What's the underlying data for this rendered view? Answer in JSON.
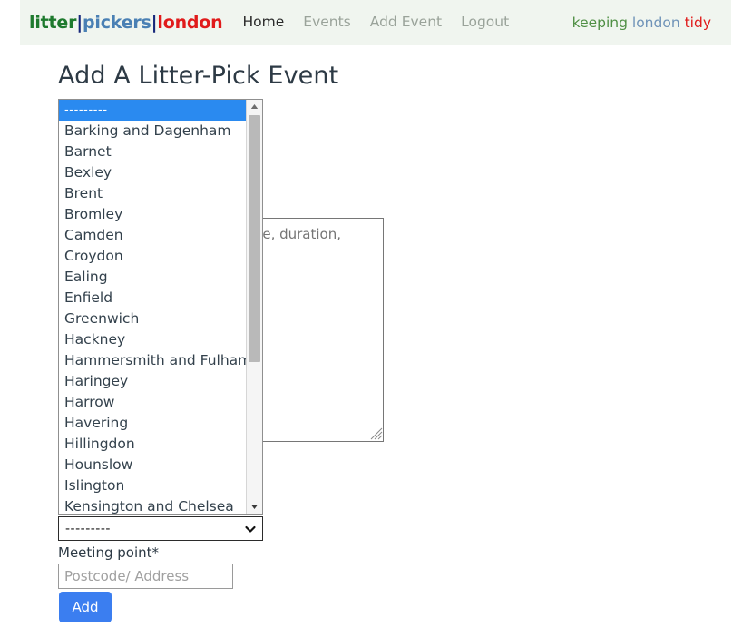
{
  "navbar": {
    "brand": {
      "part1": "litter",
      "sep1": "|",
      "part2": "pickers",
      "sep2": "|",
      "part3": "london"
    },
    "links": [
      {
        "label": "Home",
        "active": true
      },
      {
        "label": "Events",
        "active": false
      },
      {
        "label": "Add Event",
        "active": false
      },
      {
        "label": "Logout",
        "active": false
      }
    ],
    "tagline": {
      "word1": "keeping",
      "word2": "london",
      "word3": "tidy"
    },
    "background": "#f0f5ef"
  },
  "page": {
    "title": "Add A Litter-Pick Event"
  },
  "form": {
    "description": {
      "placeholder": "Details of the Litter-Pick. Time, duration, contact details..."
    },
    "borough_select": {
      "value": "---------",
      "caret_icon": "chevron-down-icon"
    },
    "meeting_point": {
      "label": "Meeting point*",
      "placeholder": "Postcode/ Address",
      "value": ""
    },
    "submit": {
      "label": "Add",
      "color": "#3b7ef0"
    }
  },
  "dropdown": {
    "open": true,
    "selected_index": 0,
    "highlight_color": "#2a8af0",
    "scrollbar": {
      "up_arrow_icon": "triangle-up-icon",
      "down_arrow_icon": "triangle-down-icon"
    },
    "options": [
      "---------",
      "Barking and Dagenham",
      "Barnet",
      "Bexley",
      "Brent",
      "Bromley",
      "Camden",
      "Croydon",
      "Ealing",
      "Enfield",
      "Greenwich",
      "Hackney",
      "Hammersmith and Fulham",
      "Haringey",
      "Harrow",
      "Havering",
      "Hillingdon",
      "Hounslow",
      "Islington",
      "Kensington and Chelsea"
    ]
  }
}
